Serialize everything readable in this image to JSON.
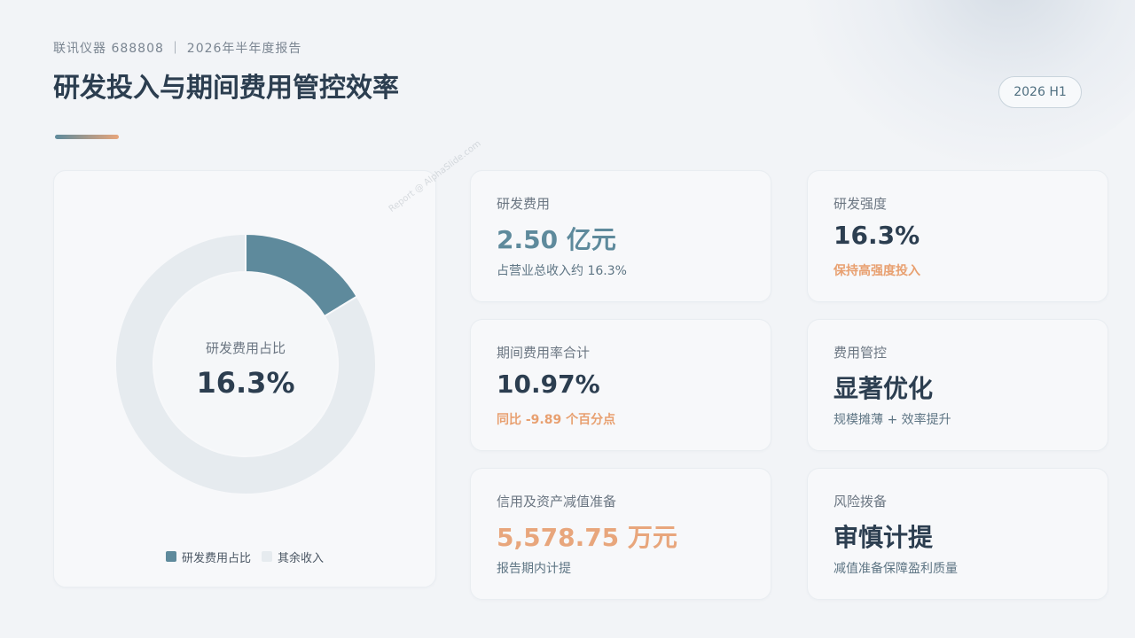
{
  "header": {
    "meta": "联讯仪器 688808 ｜ 2026年半年度报告",
    "title": "研发投入与期间费用管控效率",
    "period_badge": "2026 H1"
  },
  "colors": {
    "accent_blue": "#5e8a9c",
    "accent_orange": "#e8a67c",
    "dark_text": "#2c3e50",
    "track_gray": "#e6ebef"
  },
  "chart_data": {
    "type": "pie",
    "style": "donut",
    "center_label": "研发费用占比",
    "center_value": "16.3%",
    "categories": [
      "研发费用占比",
      "其余收入"
    ],
    "values": [
      16.3,
      83.7
    ],
    "colors": [
      "#5e8a9c",
      "#e6ebef"
    ],
    "legend_position": "bottom"
  },
  "kpis": [
    {
      "label": "研发费用",
      "value": "2.50 亿元",
      "value_color": "#5e8a9c",
      "sub": "占营业总收入约 16.3%",
      "sub_highlight": false
    },
    {
      "label": "研发强度",
      "value": "16.3%",
      "value_color": "#2c3e50",
      "sub": "保持高强度投入",
      "sub_highlight": true
    },
    {
      "label": "期间费用率合计",
      "value": "10.97%",
      "value_color": "#2c3e50",
      "sub": "同比 -9.89 个百分点",
      "sub_highlight": true
    },
    {
      "label": "费用管控",
      "value": "显著优化",
      "value_color": "#2c3e50",
      "sub": "规模摊薄 + 效率提升",
      "sub_highlight": false
    },
    {
      "label": "信用及资产减值准备",
      "value": "5,578.75 万元",
      "value_color": "#e8a67c",
      "sub": "报告期内计提",
      "sub_highlight": false
    },
    {
      "label": "风险拨备",
      "value": "审慎计提",
      "value_color": "#2c3e50",
      "sub": "减值准备保障盈利质量",
      "sub_highlight": false
    }
  ],
  "watermark": "Report @ AlphaSlide.com"
}
